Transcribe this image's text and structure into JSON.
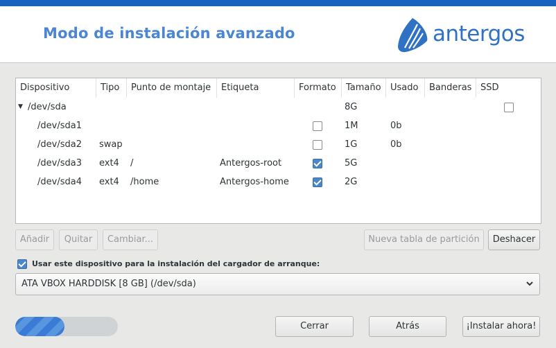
{
  "header": {
    "title": "Modo de instalación avanzado",
    "logo_text": "antergos"
  },
  "table": {
    "columns": [
      "Dispositivo",
      "Tipo",
      "Punto de montaje",
      "Etiqueta",
      "Formato",
      "Tamaño",
      "Usado",
      "Banderas",
      "SSD"
    ],
    "rows": [
      {
        "device": "/dev/sda",
        "type": "",
        "mount": "",
        "label": "",
        "format": null,
        "size": "8G",
        "used": "",
        "flags": "",
        "ssd": false,
        "expanded": true,
        "indent": 0
      },
      {
        "device": "/dev/sda1",
        "type": "",
        "mount": "",
        "label": "",
        "format": false,
        "size": "1M",
        "used": "0b",
        "flags": "",
        "ssd": null,
        "indent": 1
      },
      {
        "device": "/dev/sda2",
        "type": "swap",
        "mount": "",
        "label": "",
        "format": false,
        "size": "1G",
        "used": "0b",
        "flags": "",
        "ssd": null,
        "indent": 1
      },
      {
        "device": "/dev/sda3",
        "type": "ext4",
        "mount": "/",
        "label": "Antergos-root",
        "format": true,
        "size": "5G",
        "used": "",
        "flags": "",
        "ssd": null,
        "indent": 1
      },
      {
        "device": "/dev/sda4",
        "type": "ext4",
        "mount": "/home",
        "label": "Antergos-home",
        "format": true,
        "size": "2G",
        "used": "",
        "flags": "",
        "ssd": null,
        "indent": 1
      }
    ]
  },
  "actions": {
    "add": "Añadir",
    "remove": "Quitar",
    "change": "Cambiar...",
    "new_table": "Nueva tabla de partición",
    "undo": "Deshacer"
  },
  "bootloader": {
    "checked": true,
    "label": "Usar este dispositivo para la instalación del cargador de arranque:",
    "device": "ATA VBOX HARDDISK [8 GB] (/dev/sda)"
  },
  "footer": {
    "progress": 0.48,
    "close": "Cerrar",
    "back": "Atrás",
    "install": "¡Instalar ahora!"
  },
  "colors": {
    "accent": "#1565c0",
    "title": "#4a86d4",
    "checkbox_on": "#4a86c8"
  }
}
